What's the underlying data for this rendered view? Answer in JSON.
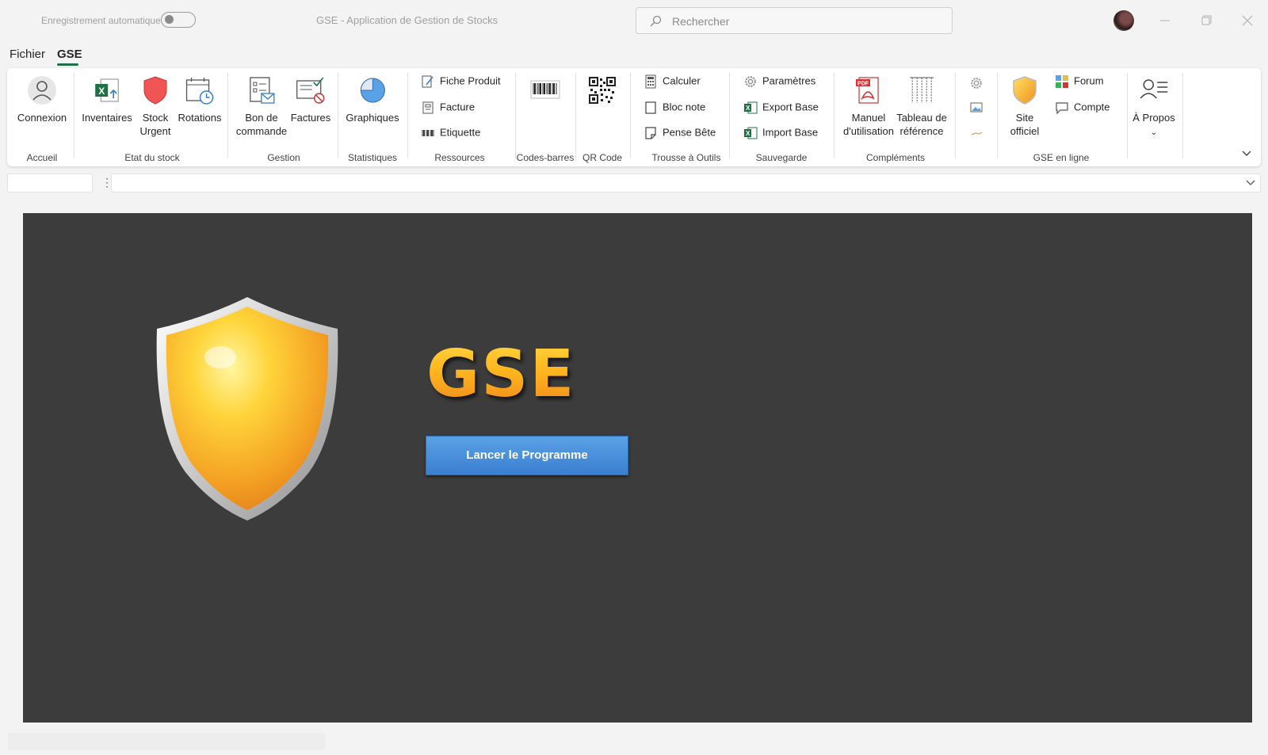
{
  "titlebar": {
    "autosave_label": "Enregistrement automatique",
    "title": "GSE - Application de Gestion de Stocks",
    "search_placeholder": "Rechercher"
  },
  "menu": {
    "file": "Fichier",
    "gse": "GSE"
  },
  "ribbon": {
    "groups": {
      "accueil": "Accueil",
      "etat_stock": "Etat du stock",
      "gestion": "Gestion",
      "statistiques": "Statistiques",
      "ressources": "Ressources",
      "codes_barres": "Codes-barres",
      "qr_code": "QR Code",
      "trousse": "Trousse à Outils",
      "sauvegarde": "Sauvegarde",
      "complements": "Compléments",
      "gse_en_ligne": "GSE en ligne"
    },
    "buttons": {
      "connexion": "Connexion",
      "inventaires": "Inventaires",
      "stock_urgent_1": "Stock",
      "stock_urgent_2": "Urgent",
      "rotations": "Rotations",
      "bon_commande_1": "Bon de",
      "bon_commande_2": "commande",
      "factures": "Factures",
      "graphiques": "Graphiques",
      "fiche_produit": "Fiche Produit",
      "facture": "Facture",
      "etiquette": "Etiquette",
      "calculer": "Calculer",
      "bloc_note": "Bloc note",
      "pense_bete": "Pense Bête",
      "parametres": "Paramètres",
      "export_base": "Export Base",
      "import_base": "Import Base",
      "manuel_1": "Manuel",
      "manuel_2": "d'utilisation",
      "tableau_1": "Tableau de",
      "tableau_2": "référence",
      "site_1": "Site",
      "site_2": "officiel",
      "forum": "Forum",
      "compte": "Compte",
      "a_propos": "À Propos"
    }
  },
  "content": {
    "logo_text": "GSE",
    "launch_button": "Lancer le Programme"
  },
  "colors": {
    "accent": "#1e7145",
    "canvas": "#3c3c3c",
    "button_blue": "#3b7fd0",
    "logo_gold": "#ffb51f"
  }
}
